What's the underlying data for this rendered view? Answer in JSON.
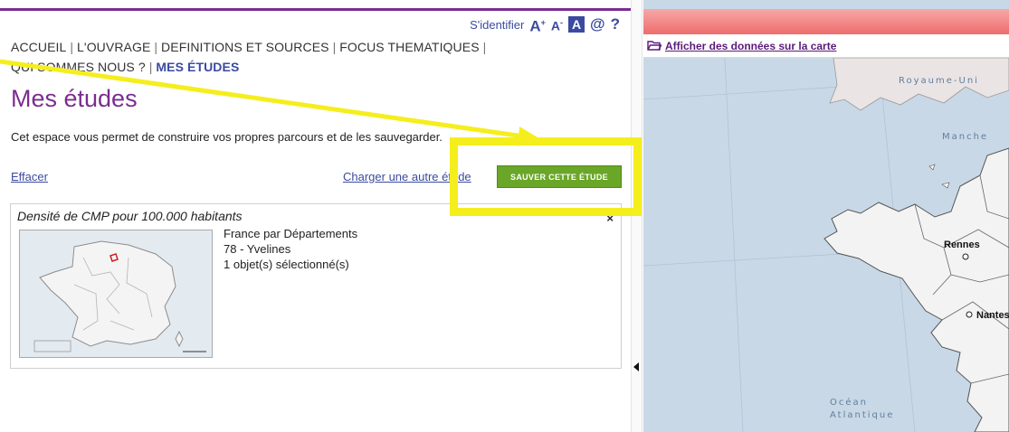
{
  "toolbar": {
    "signin": "S'identifier",
    "font_bigger": "A",
    "font_bigger_sup": "+",
    "font_smaller": "A",
    "font_smaller_sup": "-",
    "contrast": "A",
    "contact": "@",
    "help": "?"
  },
  "nav": {
    "items": [
      {
        "label": "ACCUEIL"
      },
      {
        "label": "L'OUVRAGE"
      },
      {
        "label": "DEFINITIONS ET SOURCES"
      },
      {
        "label": "FOCUS THEMATIQUES"
      },
      {
        "label": "QUI SOMMES NOUS ?"
      },
      {
        "label": "MES ÉTUDES"
      }
    ]
  },
  "page": {
    "title": "Mes études",
    "intro": "Cet espace vous permet de construire vos propres parcours et de les sauvegarder."
  },
  "actions": {
    "clear": "Effacer",
    "load": "Charger une autre étude",
    "save": "Sauver cette étude"
  },
  "study_card": {
    "title": "Densité de CMP pour 100.000 habitants",
    "close": "×",
    "level": "France par Départements",
    "selection": "78 - Yvelines",
    "count": "1 objet(s) sélectionné(s)"
  },
  "map": {
    "show_data_link": "Afficher des données sur la carte",
    "labels": {
      "uk": "Royaume-Uni",
      "manche": "Manche",
      "ocean_line1": "Océan",
      "ocean_line2": "Atlantique"
    },
    "cities": [
      "Rennes",
      "Nantes"
    ]
  },
  "colors": {
    "accent_purple": "#7a2d8f",
    "link_blue": "#3b4aa0",
    "save_green": "#6aa628",
    "annotation_yellow": "#f5ee1d"
  }
}
